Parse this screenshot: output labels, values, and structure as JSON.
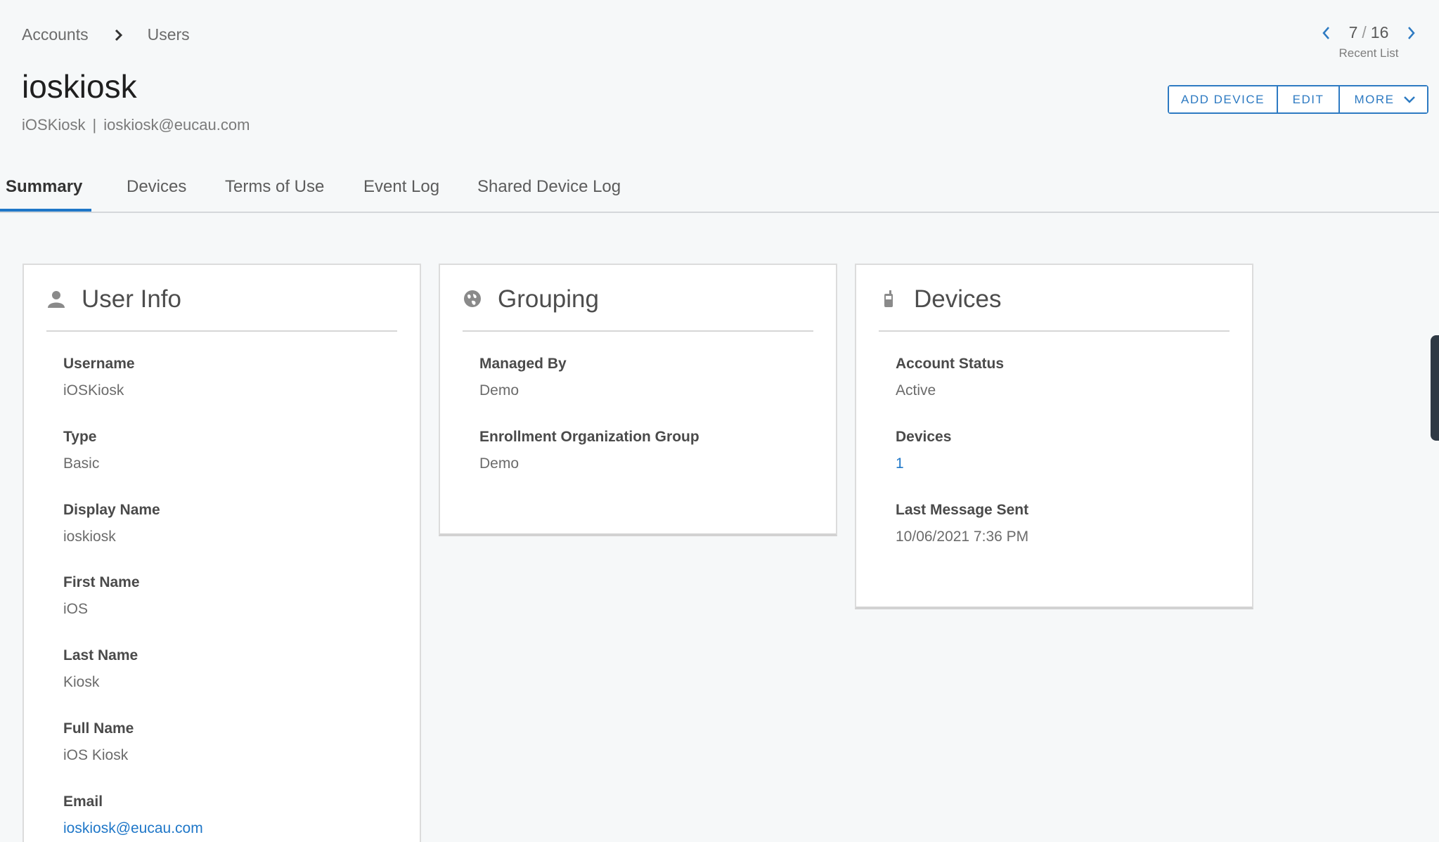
{
  "breadcrumb": {
    "accounts": "Accounts",
    "users": "Users"
  },
  "page": {
    "title": "ioskiosk",
    "username": "iOSKiosk",
    "separator": "|",
    "email": "ioskiosk@eucau.com"
  },
  "pager": {
    "current": "7",
    "slash": "/",
    "total": "16",
    "label": "Recent List"
  },
  "actions": {
    "add_device": "ADD DEVICE",
    "edit": "EDIT",
    "more": "MORE"
  },
  "tabs": [
    "Summary",
    "Devices",
    "Terms of Use",
    "Event Log",
    "Shared Device Log"
  ],
  "user_info": {
    "title": "User Info",
    "fields": [
      {
        "label": "Username",
        "value": "iOSKiosk"
      },
      {
        "label": "Type",
        "value": "Basic"
      },
      {
        "label": "Display Name",
        "value": "ioskiosk"
      },
      {
        "label": "First Name",
        "value": "iOS"
      },
      {
        "label": "Last Name",
        "value": "Kiosk"
      },
      {
        "label": "Full Name",
        "value": "iOS Kiosk"
      },
      {
        "label": "Email",
        "value": "ioskiosk@eucau.com"
      }
    ]
  },
  "grouping": {
    "title": "Grouping",
    "fields": [
      {
        "label": "Managed By",
        "value": "Demo"
      },
      {
        "label": "Enrollment Organization Group",
        "value": "Demo"
      }
    ]
  },
  "devices": {
    "title": "Devices",
    "fields": [
      {
        "label": "Account Status",
        "value": "Active"
      },
      {
        "label": "Devices",
        "value": "1"
      },
      {
        "label": "Last Message Sent",
        "value": "10/06/2021 7:36 PM"
      }
    ]
  },
  "colors": {
    "accent": "#1f77c8",
    "background": "#f6f8f9",
    "card": "#ffffff"
  },
  "icons": {
    "user_info": "user-icon",
    "grouping": "globe-icon",
    "devices": "phone-icon"
  }
}
